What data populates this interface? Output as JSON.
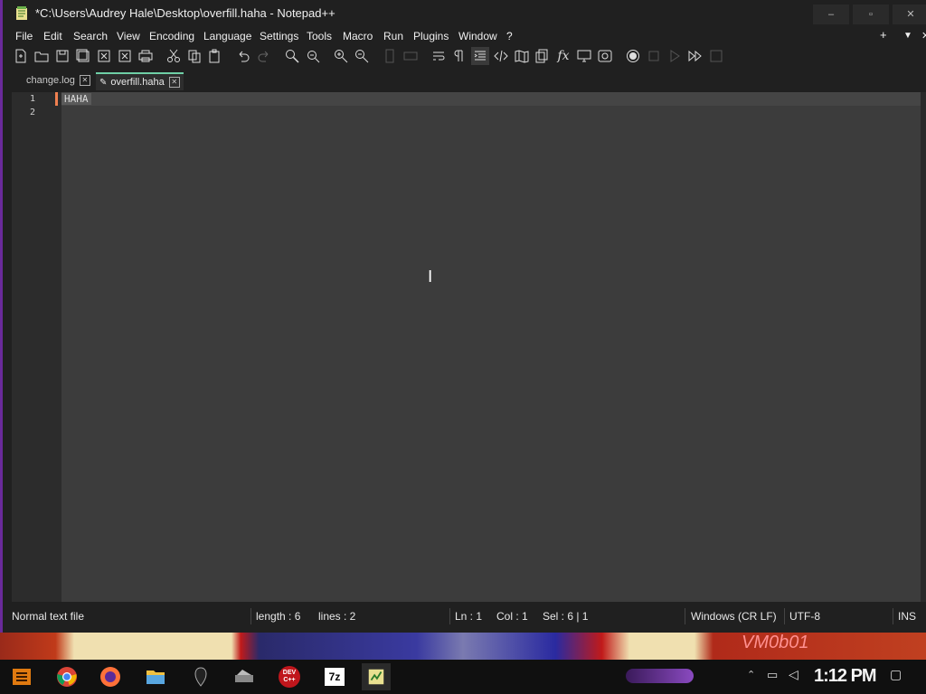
{
  "window": {
    "title": "*C:\\Users\\Audrey Hale\\Desktop\\overfill.haha - Notepad++",
    "min_label": "–",
    "max_label": "▫",
    "close_label": "✕"
  },
  "menu": {
    "items": [
      "File",
      "Edit",
      "Search",
      "View",
      "Encoding",
      "Language",
      "Settings",
      "Tools",
      "Macro",
      "Run",
      "Plugins",
      "Window",
      "?"
    ],
    "plus": "+",
    "dropdown": "▼",
    "close": "✕"
  },
  "toolbar": {
    "icons": [
      "new-file-icon",
      "open-file-icon",
      "save-icon",
      "save-all-icon",
      "close-icon",
      "close-all-icon",
      "print-icon",
      "cut-icon",
      "copy-icon",
      "paste-icon",
      "undo-icon",
      "redo-icon",
      "find-icon",
      "replace-icon",
      "zoom-in-icon",
      "zoom-out-icon",
      "sync-v-icon",
      "sync-h-icon",
      "word-wrap-icon",
      "show-all-chars-icon",
      "indent-guide-icon",
      "code-icon",
      "doc-map-icon",
      "doc-list-icon",
      "function-list-icon",
      "folder-monitor-icon",
      "monitor-icon",
      "record-macro-icon",
      "stop-macro-icon",
      "play-macro-icon",
      "run-multiple-macro-icon",
      "save-macro-icon"
    ]
  },
  "tabs": [
    {
      "label": "change.log",
      "active": false
    },
    {
      "label": "overfill.haha",
      "active": true
    }
  ],
  "editor": {
    "lines": [
      "HAHA",
      ""
    ],
    "line_numbers": [
      "1",
      "2"
    ]
  },
  "status": {
    "file_type": "Normal text file",
    "length": "length : 6",
    "lines": "lines : 2",
    "ln": "Ln : 1",
    "col": "Col : 1",
    "sel": "Sel : 6 | 1",
    "eol": "Windows (CR LF)",
    "encoding": "UTF-8",
    "mode": "INS"
  },
  "wallpaper_text": "VM0b01",
  "taskbar": {
    "apps": [
      "start-icon",
      "chrome-icon",
      "firefox-icon",
      "file-explorer-icon",
      "app-icon",
      "network-tool-icon",
      "devcpp-icon",
      "7zip-icon",
      "notepadpp-icon"
    ],
    "devcpp_label": "DEV C++",
    "sevenzip_label": "7z",
    "clock": "1:12 PM"
  },
  "colors": {
    "accent": "#6fcfa6",
    "caret": "#f08050",
    "window_border": "#6a2a9a"
  }
}
